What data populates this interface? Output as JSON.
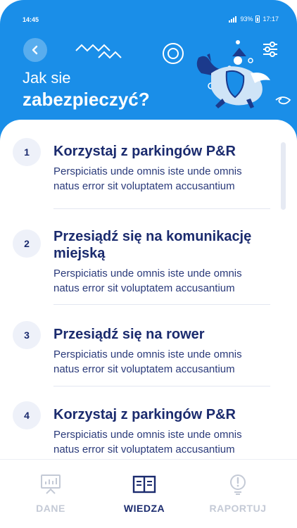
{
  "status_bar": {
    "time": "14:45",
    "battery": "93%",
    "clock": "17:17"
  },
  "header": {
    "title_line1": "Jak sie",
    "title_line2": "zabezpieczyć?",
    "back_icon": "chevron-left-icon",
    "settings_icon": "sliders-icon",
    "bg_color": "#1a8ee8"
  },
  "list": {
    "items": [
      {
        "number": "1",
        "title": "Korzystaj z parkingów P&R",
        "desc_line1": "Perspiciatis unde omnis iste unde omnis",
        "desc_line2": "natus error sit voluptatem accusantium"
      },
      {
        "number": "2",
        "title_line1": "Przesiądź się na komunikację",
        "title_line2": "miejską",
        "desc_line1": "Perspiciatis unde omnis iste unde omnis",
        "desc_line2": "natus error sit voluptatem accusantium"
      },
      {
        "number": "3",
        "title": "Przesiądź się na rower",
        "desc_line1": "Perspiciatis unde omnis iste unde omnis",
        "desc_line2": "natus error sit voluptatem accusantium"
      },
      {
        "number": "4",
        "title": "Korzystaj z parkingów P&R",
        "desc_line1": "Perspiciatis unde omnis iste unde omnis",
        "desc_line2": "natus error sit voluptatem accusantium"
      }
    ]
  },
  "tabbar": {
    "tabs": [
      {
        "label": "DANE",
        "icon": "chart-board-icon",
        "active": false
      },
      {
        "label": "WIEDZA",
        "icon": "open-book-icon",
        "active": true
      },
      {
        "label": "RAPORTUJ",
        "icon": "alert-bulb-icon",
        "active": false
      }
    ]
  },
  "colors": {
    "primary": "#1a8ee8",
    "navy": "#1b2b6e",
    "inactive": "#c4cad6"
  }
}
